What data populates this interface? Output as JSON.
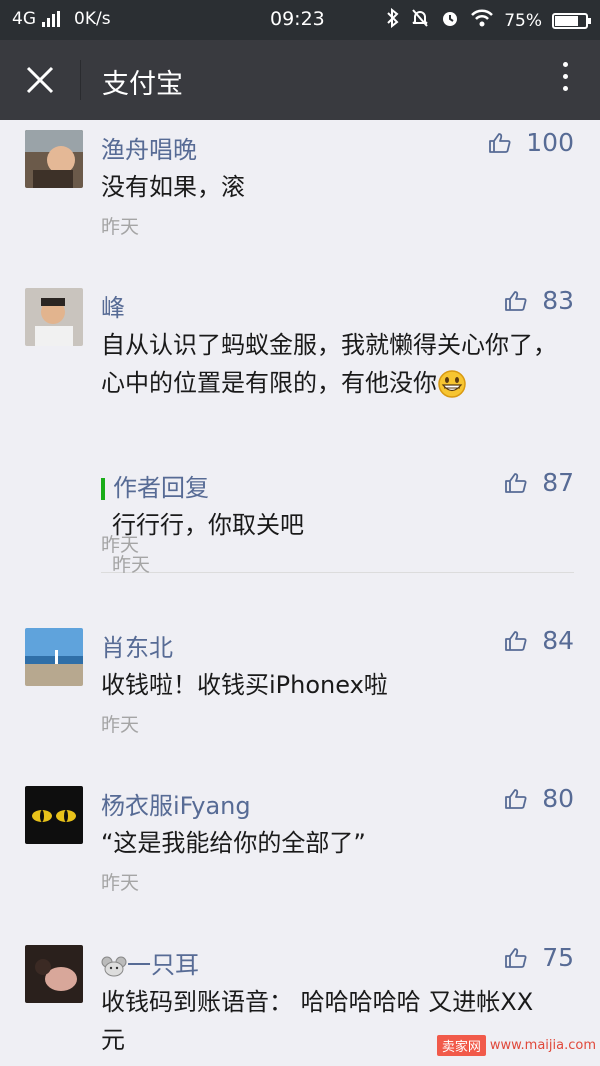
{
  "status_bar": {
    "network": "4G",
    "speed": "0K/s",
    "time": "09:23",
    "battery": "75%",
    "battery_level": 0.75
  },
  "nav": {
    "title": "支付宝"
  },
  "comments": [
    {
      "name": "渔舟唱晚",
      "likes": "100",
      "text": "没有如果，滚",
      "time": "昨天"
    },
    {
      "name": "峰",
      "likes": "83",
      "text": "自从认识了蚂蚁金服，我就懒得关心你了，心中的位置是有限的，有他没你",
      "time": "昨天",
      "reply": {
        "label": "作者回复",
        "likes": "87",
        "text": "行行行，你取关吧",
        "time": "昨天"
      }
    },
    {
      "name": "肖东北",
      "likes": "84",
      "text": "收钱啦！收钱买iPhonex啦",
      "time": "昨天"
    },
    {
      "name": "杨衣服iFyang",
      "likes": "80",
      "text": "“这是我能给你的全部了”",
      "time": "昨天"
    },
    {
      "name": "一只耳",
      "likes": "75",
      "text": "收钱码到账语音： 哈哈哈哈哈 又进帐XX元"
    }
  ],
  "watermark": {
    "tag": "卖家网",
    "url": "www.maijia.com"
  },
  "colors": {
    "status_bar": "#2b2f33",
    "nav_bar": "#393a3f",
    "link_blue": "#576b95",
    "reply_green": "#1aad19"
  }
}
